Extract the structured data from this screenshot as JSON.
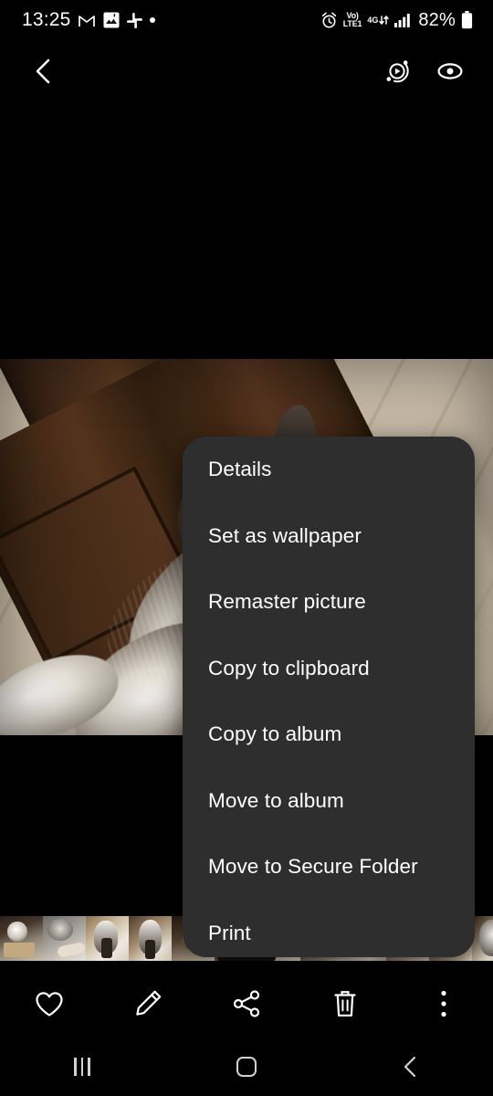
{
  "status_bar": {
    "time": "13:25",
    "left_icons": [
      "gmail-icon",
      "messenger-icon",
      "slack-icon",
      "notification-dot"
    ],
    "alarm_icon": "alarm-icon",
    "volte_label_top": "Vo)",
    "volte_label_bottom": "LTE1",
    "network_type": "4G",
    "data_arrows": "↓↑",
    "signal_icon": "signal-bars-icon",
    "battery_percent": "82%",
    "battery_icon": "battery-icon"
  },
  "app_bar": {
    "back_icon": "chevron-left-icon",
    "motion_photo_icon": "motion-photo-icon",
    "view_icon": "eye-icon"
  },
  "viewer": {
    "photo_alt": "husky-dog-lying-by-wooden-door"
  },
  "context_menu": {
    "items": [
      {
        "label": "Details"
      },
      {
        "label": "Set as wallpaper"
      },
      {
        "label": "Remaster picture"
      },
      {
        "label": "Copy to clipboard"
      },
      {
        "label": "Copy to album"
      },
      {
        "label": "Move to album"
      },
      {
        "label": "Move to Secure Folder"
      },
      {
        "label": "Print"
      }
    ],
    "background_color": "#2e2e2e",
    "text_color": "#ffffff"
  },
  "filmstrip": {
    "thumbnails": [
      {
        "name": "husky-in-box-thumb"
      },
      {
        "name": "husky-on-couch-thumb"
      },
      {
        "name": "husky-standing-thumb"
      },
      {
        "name": "husky-portrait-thumb"
      },
      {
        "name": "husky-hallway-thumb"
      },
      {
        "name": "husky-door-thumb"
      },
      {
        "name": "husky-floor-thumb"
      },
      {
        "name": "husky-sleep-thumb"
      },
      {
        "name": "husky-close-thumb"
      },
      {
        "name": "husky-window-thumb"
      },
      {
        "name": "husky-stairs-thumb"
      },
      {
        "name": "husky-selected-thumb"
      }
    ],
    "selected_index": 11
  },
  "action_bar": {
    "buttons": [
      {
        "name": "favorite-button",
        "icon": "heart-icon"
      },
      {
        "name": "edit-button",
        "icon": "pencil-icon"
      },
      {
        "name": "share-button",
        "icon": "share-icon"
      },
      {
        "name": "delete-button",
        "icon": "trash-icon"
      },
      {
        "name": "more-options-button",
        "icon": "more-vertical-icon"
      }
    ]
  },
  "system_nav": {
    "recents_icon": "recents-icon",
    "home_icon": "home-icon",
    "back_icon": "back-chevron-icon"
  }
}
